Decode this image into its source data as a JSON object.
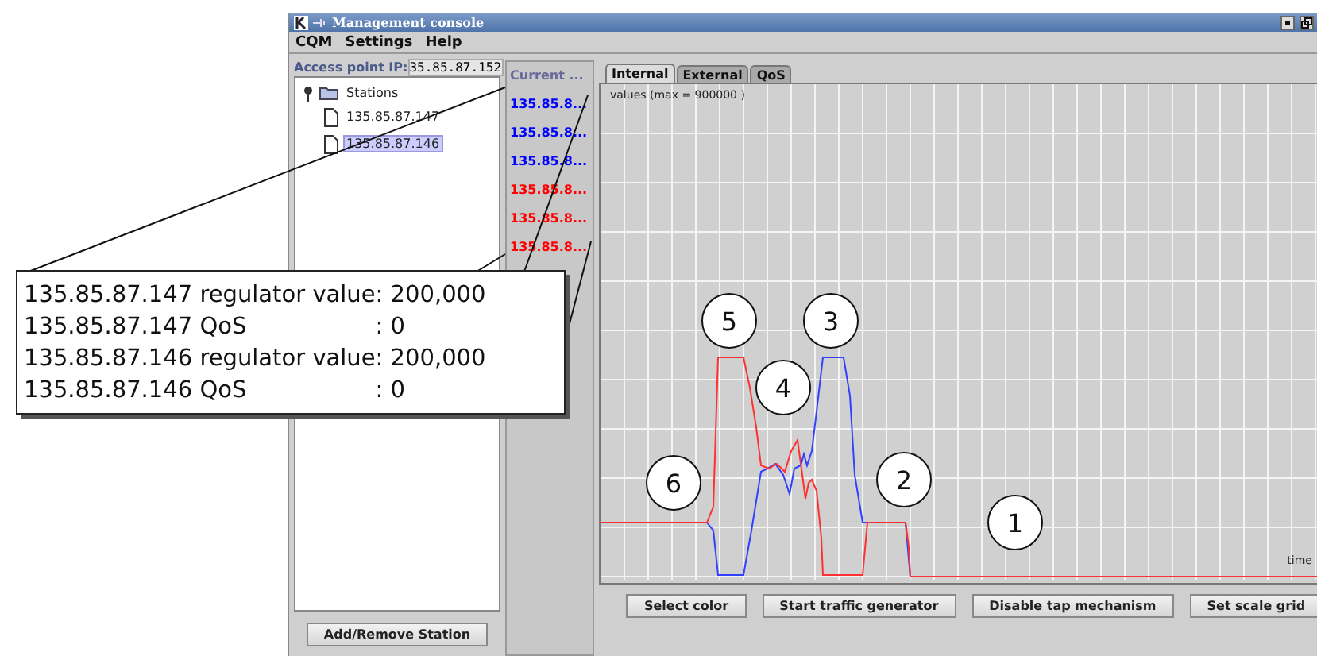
{
  "window": {
    "title": "Management console"
  },
  "menu": [
    "CQM",
    "Settings",
    "Help"
  ],
  "access_point": {
    "label": "Access point IP:",
    "value": "35.85.87.152"
  },
  "tree": {
    "label": "Stations",
    "expanded": true,
    "children": [
      {
        "label": "135.85.87.147",
        "selected": false
      },
      {
        "label": "135.85.87.146",
        "selected": true
      }
    ]
  },
  "station_button": "Add/Remove Station",
  "current_list": {
    "header": "Current ...",
    "items": [
      {
        "label": "135.85.8...",
        "color": "#0000ff"
      },
      {
        "label": "135.85.8...",
        "color": "#0000ff"
      },
      {
        "label": "135.85.8...",
        "color": "#0000ff"
      },
      {
        "label": "135.85.8...",
        "color": "#ff0000"
      },
      {
        "label": "135.85.8...",
        "color": "#ff0000"
      },
      {
        "label": "135.85.8...",
        "color": "#ff0000"
      }
    ]
  },
  "tabs": [
    {
      "label": "Internal",
      "selected": true
    },
    {
      "label": "External",
      "selected": false
    },
    {
      "label": "QoS",
      "selected": false
    }
  ],
  "chart": {
    "y_caption": "values (max = 900000 )",
    "x_caption": "time",
    "markers": [
      "1",
      "2",
      "3",
      "4",
      "5",
      "6"
    ]
  },
  "buttons": [
    "Select color",
    "Start traffic generator",
    "Disable tap mechanism",
    "Set scale grid"
  ],
  "callout": {
    "rows": [
      {
        "label": "135.85.87.147 regulator value",
        "value": ": 200,000"
      },
      {
        "label": "135.85.87.147 QoS",
        "value": ": 0"
      },
      {
        "label": "135.85.87.146 regulator value",
        "value": ": 200,000"
      },
      {
        "label": "135.85.87.146 QoS",
        "value": ": 0"
      }
    ]
  }
}
